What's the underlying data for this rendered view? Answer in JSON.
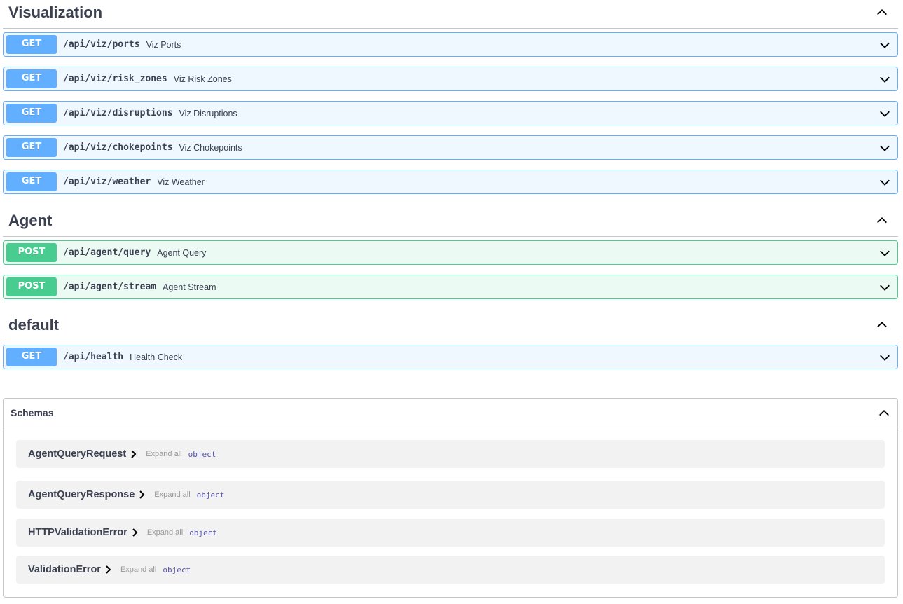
{
  "sections": [
    {
      "title": "Visualization",
      "operations": [
        {
          "method": "GET",
          "path": "/api/viz/ports",
          "summary": "Viz Ports"
        },
        {
          "method": "GET",
          "path": "/api/viz/risk_zones",
          "summary": "Viz Risk Zones"
        },
        {
          "method": "GET",
          "path": "/api/viz/disruptions",
          "summary": "Viz Disruptions"
        },
        {
          "method": "GET",
          "path": "/api/viz/chokepoints",
          "summary": "Viz Chokepoints"
        },
        {
          "method": "GET",
          "path": "/api/viz/weather",
          "summary": "Viz Weather"
        }
      ]
    },
    {
      "title": "Agent",
      "operations": [
        {
          "method": "POST",
          "path": "/api/agent/query",
          "summary": "Agent Query"
        },
        {
          "method": "POST",
          "path": "/api/agent/stream",
          "summary": "Agent Stream"
        }
      ]
    },
    {
      "title": "default",
      "operations": [
        {
          "method": "GET",
          "path": "/api/health",
          "summary": "Health Check"
        }
      ]
    }
  ],
  "schemas": {
    "title": "Schemas",
    "models": [
      {
        "name": "AgentQueryRequest",
        "expand": "Expand all",
        "type": "object"
      },
      {
        "name": "AgentQueryResponse",
        "expand": "Expand all",
        "type": "object"
      },
      {
        "name": "HTTPValidationError",
        "expand": "Expand all",
        "type": "object"
      },
      {
        "name": "ValidationError",
        "expand": "Expand all",
        "type": "object"
      }
    ]
  },
  "colors": {
    "get": "#61affe",
    "post": "#49cc90",
    "text": "#3b4151",
    "model_type": "#5555aa"
  },
  "icons": {
    "section_toggle": "chevron-up-icon",
    "operation_toggle": "chevron-down-icon",
    "model_toggle": "chevron-right-icon"
  }
}
